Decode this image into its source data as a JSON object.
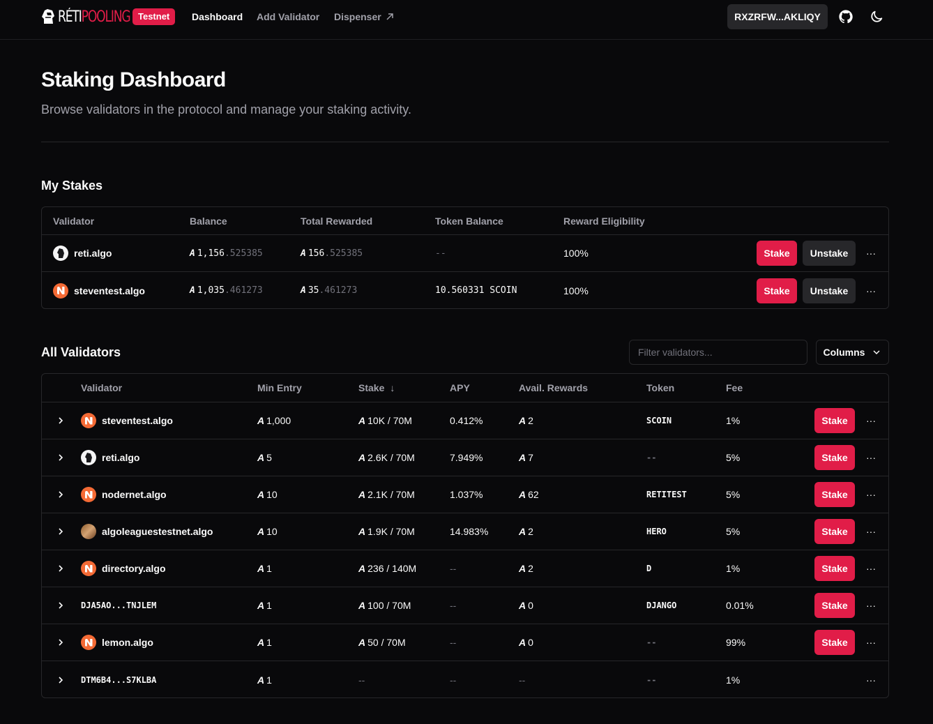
{
  "header": {
    "logo_part1": "RÉTI",
    "logo_part2": "POOLING",
    "badge": "Testnet",
    "nav": [
      "Dashboard",
      "Add Validator",
      "Dispenser"
    ],
    "wallet": "RXZRFW...AKLIQY",
    "icons": [
      "github-icon",
      "moon-icon"
    ]
  },
  "page": {
    "title": "Staking Dashboard",
    "subtitle": "Browse validators in the protocol and manage your staking activity."
  },
  "my_stakes": {
    "title": "My Stakes",
    "columns": [
      "Validator",
      "Balance",
      "Total Rewarded",
      "Token Balance",
      "Reward Eligibility"
    ],
    "rows": [
      {
        "avatar": "knight",
        "validator": "reti.algo",
        "balance_int": "1,156",
        "balance_dec": ".525385",
        "rewarded_int": "156",
        "rewarded_dec": ".525385",
        "token_balance": "--",
        "eligibility": "100%",
        "stake": "Stake",
        "unstake": "Unstake"
      },
      {
        "avatar": "nfd",
        "validator": "steventest.algo",
        "balance_int": "1,035",
        "balance_dec": ".461273",
        "rewarded_int": "35",
        "rewarded_dec": ".461273",
        "token_balance": "10.560331 SCOIN",
        "eligibility": "100%",
        "stake": "Stake",
        "unstake": "Unstake"
      }
    ]
  },
  "all_validators": {
    "title": "All Validators",
    "filter_placeholder": "Filter validators...",
    "columns_button": "Columns",
    "columns": [
      "Validator",
      "Min Entry",
      "Stake",
      "APY",
      "Avail. Rewards",
      "Token",
      "Fee"
    ],
    "sort_indicator": "↓",
    "rows": [
      {
        "avatar": "nfd",
        "mono": false,
        "validator": "steventest.algo",
        "min_entry": "1,000",
        "stake": "10K / 70M",
        "apy": "0.412%",
        "rewards": "2",
        "token": "SCOIN",
        "fee": "1%",
        "stake_btn": "Stake"
      },
      {
        "avatar": "knight",
        "mono": false,
        "validator": "reti.algo",
        "min_entry": "5",
        "stake": "2.6K / 70M",
        "apy": "7.949%",
        "rewards": "7",
        "token": "--",
        "fee": "5%",
        "stake_btn": "Stake"
      },
      {
        "avatar": "nfd",
        "mono": false,
        "validator": "nodernet.algo",
        "min_entry": "10",
        "stake": "2.1K / 70M",
        "apy": "1.037%",
        "rewards": "62",
        "token": "RETITEST",
        "fee": "5%",
        "stake_btn": "Stake"
      },
      {
        "avatar": "league",
        "mono": false,
        "validator": "algoleaguestestnet.algo",
        "min_entry": "10",
        "stake": "1.9K / 70M",
        "apy": "14.983%",
        "rewards": "2",
        "token": "HERO",
        "fee": "5%",
        "stake_btn": "Stake"
      },
      {
        "avatar": "nfd",
        "mono": false,
        "validator": "directory.algo",
        "min_entry": "1",
        "stake": "236 / 140M",
        "apy": "--",
        "rewards": "2",
        "token": "D",
        "fee": "1%",
        "stake_btn": "Stake"
      },
      {
        "avatar": "none",
        "mono": true,
        "validator": "DJA5AO...TNJLEM",
        "min_entry": "1",
        "stake": "100 / 70M",
        "apy": "--",
        "rewards": "0",
        "token": "DJANGO",
        "fee": "0.01%",
        "stake_btn": "Stake"
      },
      {
        "avatar": "nfd",
        "mono": false,
        "validator": "lemon.algo",
        "min_entry": "1",
        "stake": "50 / 70M",
        "apy": "--",
        "rewards": "0",
        "token": "--",
        "fee": "99%",
        "stake_btn": "Stake"
      },
      {
        "avatar": "none",
        "mono": true,
        "validator": "DTM6B4...S7KLBA",
        "min_entry": "1",
        "stake": "--",
        "apy": "--",
        "rewards": "--",
        "token": "--",
        "fee": "1%",
        "stake_btn": ""
      }
    ]
  },
  "colors": {
    "accent": "#e11d48",
    "background": "#09090b",
    "border": "#27272a",
    "muted": "#a1a1aa"
  }
}
